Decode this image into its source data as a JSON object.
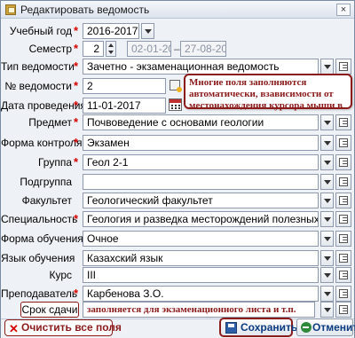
{
  "window": {
    "title": "Редактировать ведомость",
    "close_glyph": "×"
  },
  "required_mark": "*",
  "fields": {
    "year": {
      "label": "Учебный год",
      "value": "2016-2017"
    },
    "semester": {
      "label": "Семестр",
      "value": "2",
      "date_from": "02-01-2017",
      "date_to": "27-08-2017",
      "separator": "–"
    },
    "sheet_type": {
      "label": "Тип ведомости",
      "value": "Зачетно - экзаменационная ведомость"
    },
    "sheet_no": {
      "label": "№ ведомости",
      "value": "2"
    },
    "date": {
      "label": "Дата проведения",
      "value": "11-01-2017"
    },
    "subject": {
      "label": "Предмет",
      "value": "Почвоведение с основами геологии"
    },
    "control_form": {
      "label": "Форма контроля",
      "value": "Экзамен"
    },
    "group": {
      "label": "Группа",
      "value": "Геол 2-1"
    },
    "subgroup": {
      "label": "Подгруппа",
      "value": ""
    },
    "faculty": {
      "label": "Факультет",
      "value": "Геологический факультет"
    },
    "specialty": {
      "label": "Специальность",
      "value": "Геология и разведка месторождений полезных ископаем"
    },
    "study_form": {
      "label": "Форма обучения",
      "value": "Очное"
    },
    "language": {
      "label": "Язык обучения",
      "value": "Казахский язык"
    },
    "course": {
      "label": "Курс",
      "value": "III"
    },
    "teacher": {
      "label": "Преподаватель",
      "value": "Карбенова З.О."
    },
    "deadline": {
      "label": "Срок сдачи",
      "note": "заполняется для экзаменационного листа и т.п."
    }
  },
  "callout": {
    "text": "Многие поля заполняются автоматически, взависимости от местонахождения курсора мыши в дереве."
  },
  "buttons": {
    "clear": "Очистить все поля",
    "save": "Сохранить",
    "cancel": "Отменить"
  },
  "colors": {
    "required_star": "#d40000",
    "annotation": "#8b1a1a",
    "button_text": "#0a3a80"
  }
}
